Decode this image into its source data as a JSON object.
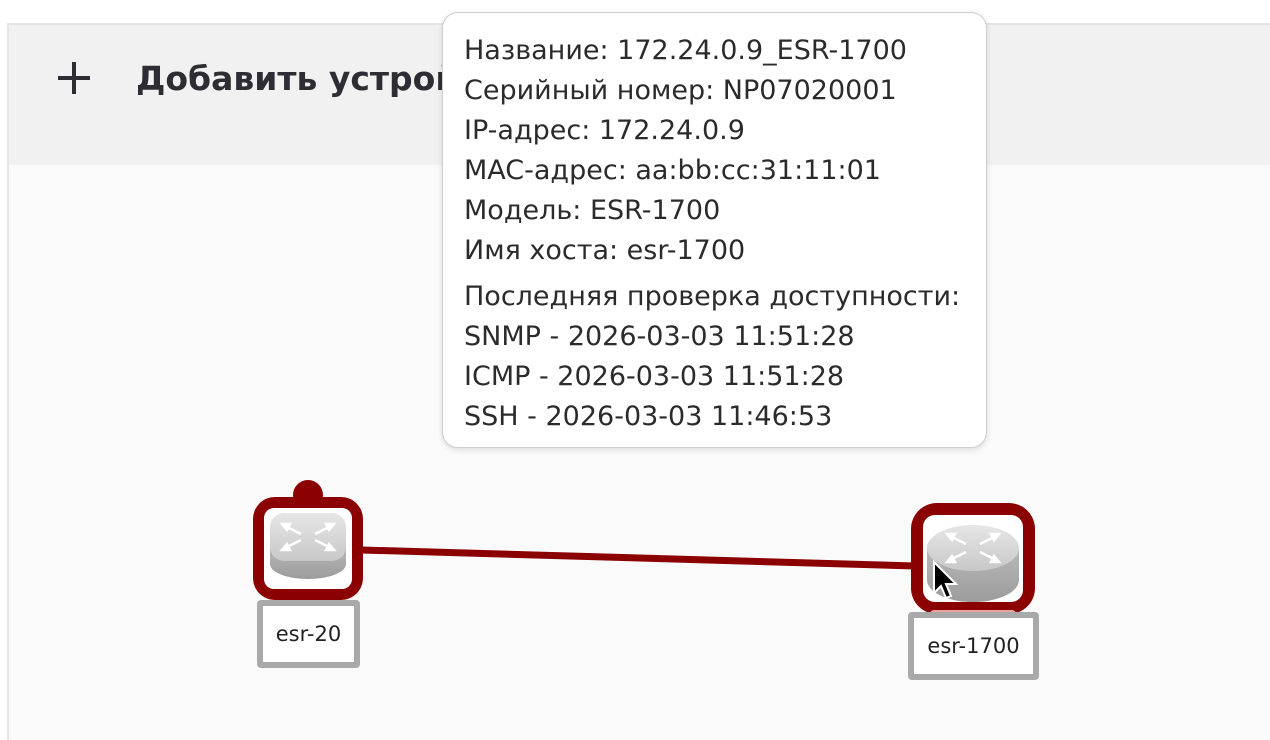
{
  "toolbar": {
    "add_device_label": "Добавить устрой",
    "add_icon": "plus-icon"
  },
  "devices": [
    {
      "label": "esr-20",
      "icon": "router-icon",
      "status_color": "#8b0000"
    },
    {
      "label": "esr-1700",
      "icon": "router-icon",
      "status_color": "#8b0000"
    }
  ],
  "link": {
    "from": "esr-20",
    "to": "esr-1700",
    "color": "#8b0000"
  },
  "tooltip": {
    "name": "Название: 172.24.0.9_ESR-1700",
    "serial": "Серийный номер: NP07020001",
    "ip": "IP-адрес: 172.24.0.9",
    "mac": "MAC-адрес: aa:bb:cc:31:11:01",
    "model": "Модель: ESR-1700",
    "hostname": "Имя хоста: esr-1700",
    "last_check_title": "Последняя проверка доступности:",
    "snmp": "SNMP - 2026-03-03 11:51:28",
    "icmp": "ICMP - 2026-03-03 11:51:28",
    "ssh": "SSH - 2026-03-03 11:46:53"
  },
  "colors": {
    "status_down": "#8b0000",
    "label_border": "#a9a9a9",
    "toolbar_bg": "#f1f1f1"
  }
}
